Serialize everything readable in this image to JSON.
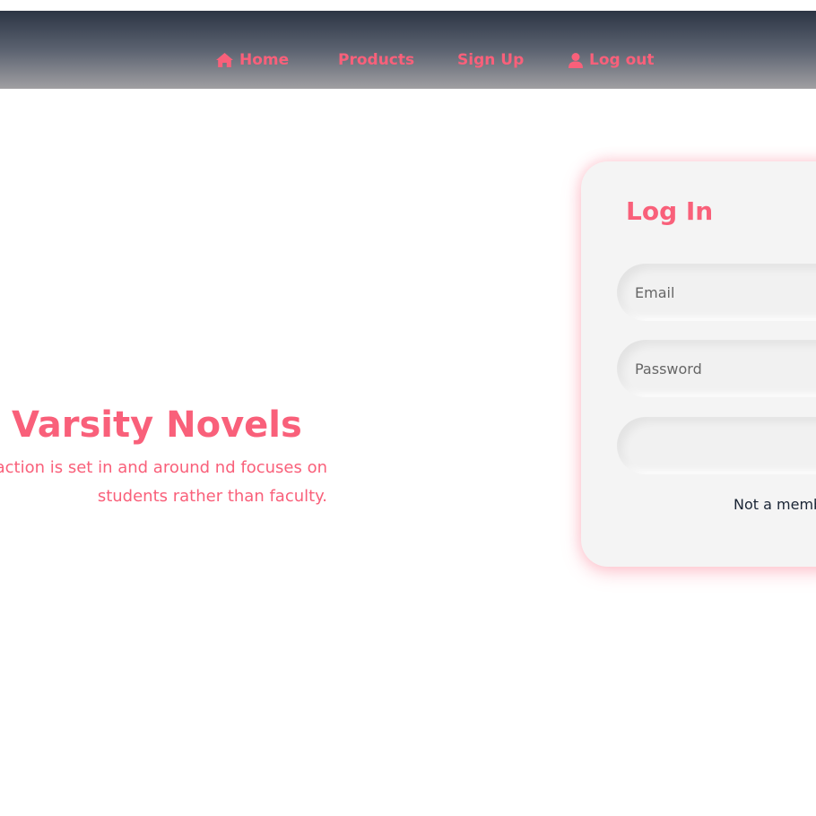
{
  "nav": {
    "home_label": "Home",
    "home_icon": "home-icon",
    "products_label": "Products",
    "signup_label": "Sign Up",
    "logout_label": "Log out",
    "logout_icon": "user-icon"
  },
  "hero": {
    "title": "Varsity Novels",
    "description": "ose main action is set in and around nd focuses on students rather than faculty."
  },
  "login": {
    "title": "Log In",
    "email_placeholder": "Email",
    "password_placeholder": "Password",
    "submit_label": "",
    "signup_prompt": "Not a memb"
  },
  "colors": {
    "accent": "#f9607a",
    "navbar_top": "#2c3544",
    "navbar_bottom": "#a09fa2",
    "card_bg": "#f4f4f4",
    "prompt_text": "#1a2535"
  }
}
